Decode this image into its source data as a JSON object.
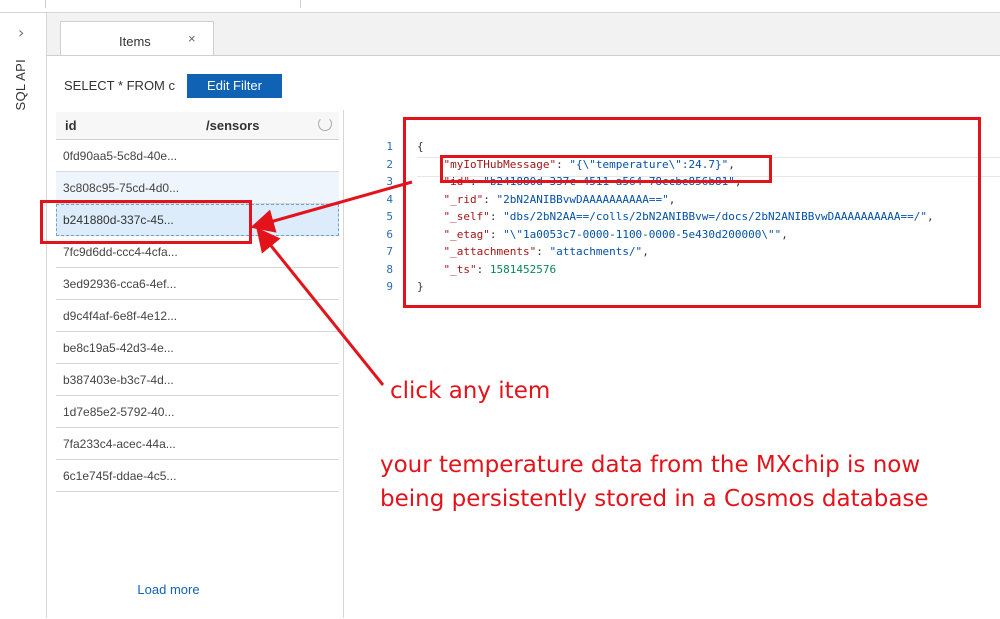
{
  "rail": {
    "chevron_glyph": "›",
    "label": "SQL API"
  },
  "tab": {
    "label": "Items",
    "close_glyph": "×"
  },
  "toolbar": {
    "query_text": "SELECT * FROM c",
    "edit_filter_label": "Edit Filter"
  },
  "table": {
    "columns": [
      "id",
      "/sensors"
    ],
    "rows": [
      "0fd90aa5-5c8d-40e...",
      "3c808c95-75cd-4d0...",
      "b241880d-337c-45...",
      "7fc9d6dd-ccc4-4cfa...",
      "3ed92936-cca6-4ef...",
      "d9c4f4af-6e8f-4e12...",
      "be8c19a5-42d3-4e...",
      "b387403e-b3c7-4d...",
      "1d7e85e2-5792-40...",
      "7fa233c4-acec-44a...",
      "6c1e745f-ddae-4c5..."
    ],
    "selected_index": 2,
    "load_more_label": "Load more"
  },
  "editor": {
    "line_numbers": [
      "1",
      "2",
      "3",
      "4",
      "5",
      "6",
      "7",
      "8",
      "9"
    ],
    "lines": {
      "l1": "{",
      "l2_key": "\"myIoTHubMessage\"",
      "l2_val": "\"{\\\"temperature\\\":24.7}\"",
      "l3_key": "\"id\"",
      "l3_val": "\"b241880d-337c-4511-a564-78ccbe856b81\"",
      "l4_key": "\"_rid\"",
      "l4_val": "\"2bN2ANIBBvwDAAAAAAAAAA==\"",
      "l5_key": "\"_self\"",
      "l5_val": "\"dbs/2bN2AA==/colls/2bN2ANIBBvw=/docs/2bN2ANIBBvwDAAAAAAAAAA==/\"",
      "l6_key": "\"_etag\"",
      "l6_val": "\"\\\"1a0053c7-0000-1100-0000-5e430d200000\\\"\"",
      "l7_key": "\"_attachments\"",
      "l7_val": "\"attachments/\"",
      "l8_key": "\"_ts\"",
      "l8_val": "1581452576",
      "l9": "}"
    }
  },
  "annotations": {
    "click_text": "click any item",
    "stored_text": "your temperature data from the MXchip is now being persistently stored in a Cosmos database",
    "color": "#e3131b"
  },
  "colors": {
    "accent": "#0f62b4",
    "selected_row": "#dcecfa"
  }
}
